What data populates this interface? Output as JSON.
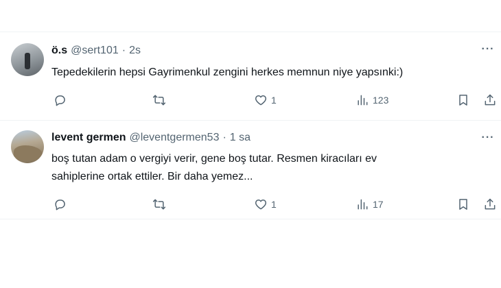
{
  "tweets": [
    {
      "display_name": "ö.s",
      "handle": "@sert101",
      "separator": "·",
      "time": "2s",
      "text_lines": [
        "Tepedekilerin hepsi Gayrimenkul zengini herkes memnun niye yapsınki:)"
      ],
      "likes": "1",
      "views": "123",
      "more": "···"
    },
    {
      "display_name": "levent germen",
      "handle": "@leventgermen53",
      "separator": "·",
      "time": "1 sa",
      "text_lines": [
        "boş tutan adam o vergiyi verir, gene boş tutar. Resmen kiracıları ev",
        "sahiplerine ortak ettiler. Bir daha yemez..."
      ],
      "likes": "1",
      "views": "17",
      "more": "···"
    }
  ],
  "icons": {
    "reply": "reply-icon",
    "retweet": "retweet-icon",
    "like": "heart-icon",
    "views": "views-icon",
    "bookmark": "bookmark-icon",
    "share": "share-icon",
    "more": "more-icon"
  },
  "colors": {
    "text_primary": "#0f1419",
    "text_secondary": "#536471",
    "divider": "#eff3f4",
    "background": "#ffffff"
  }
}
